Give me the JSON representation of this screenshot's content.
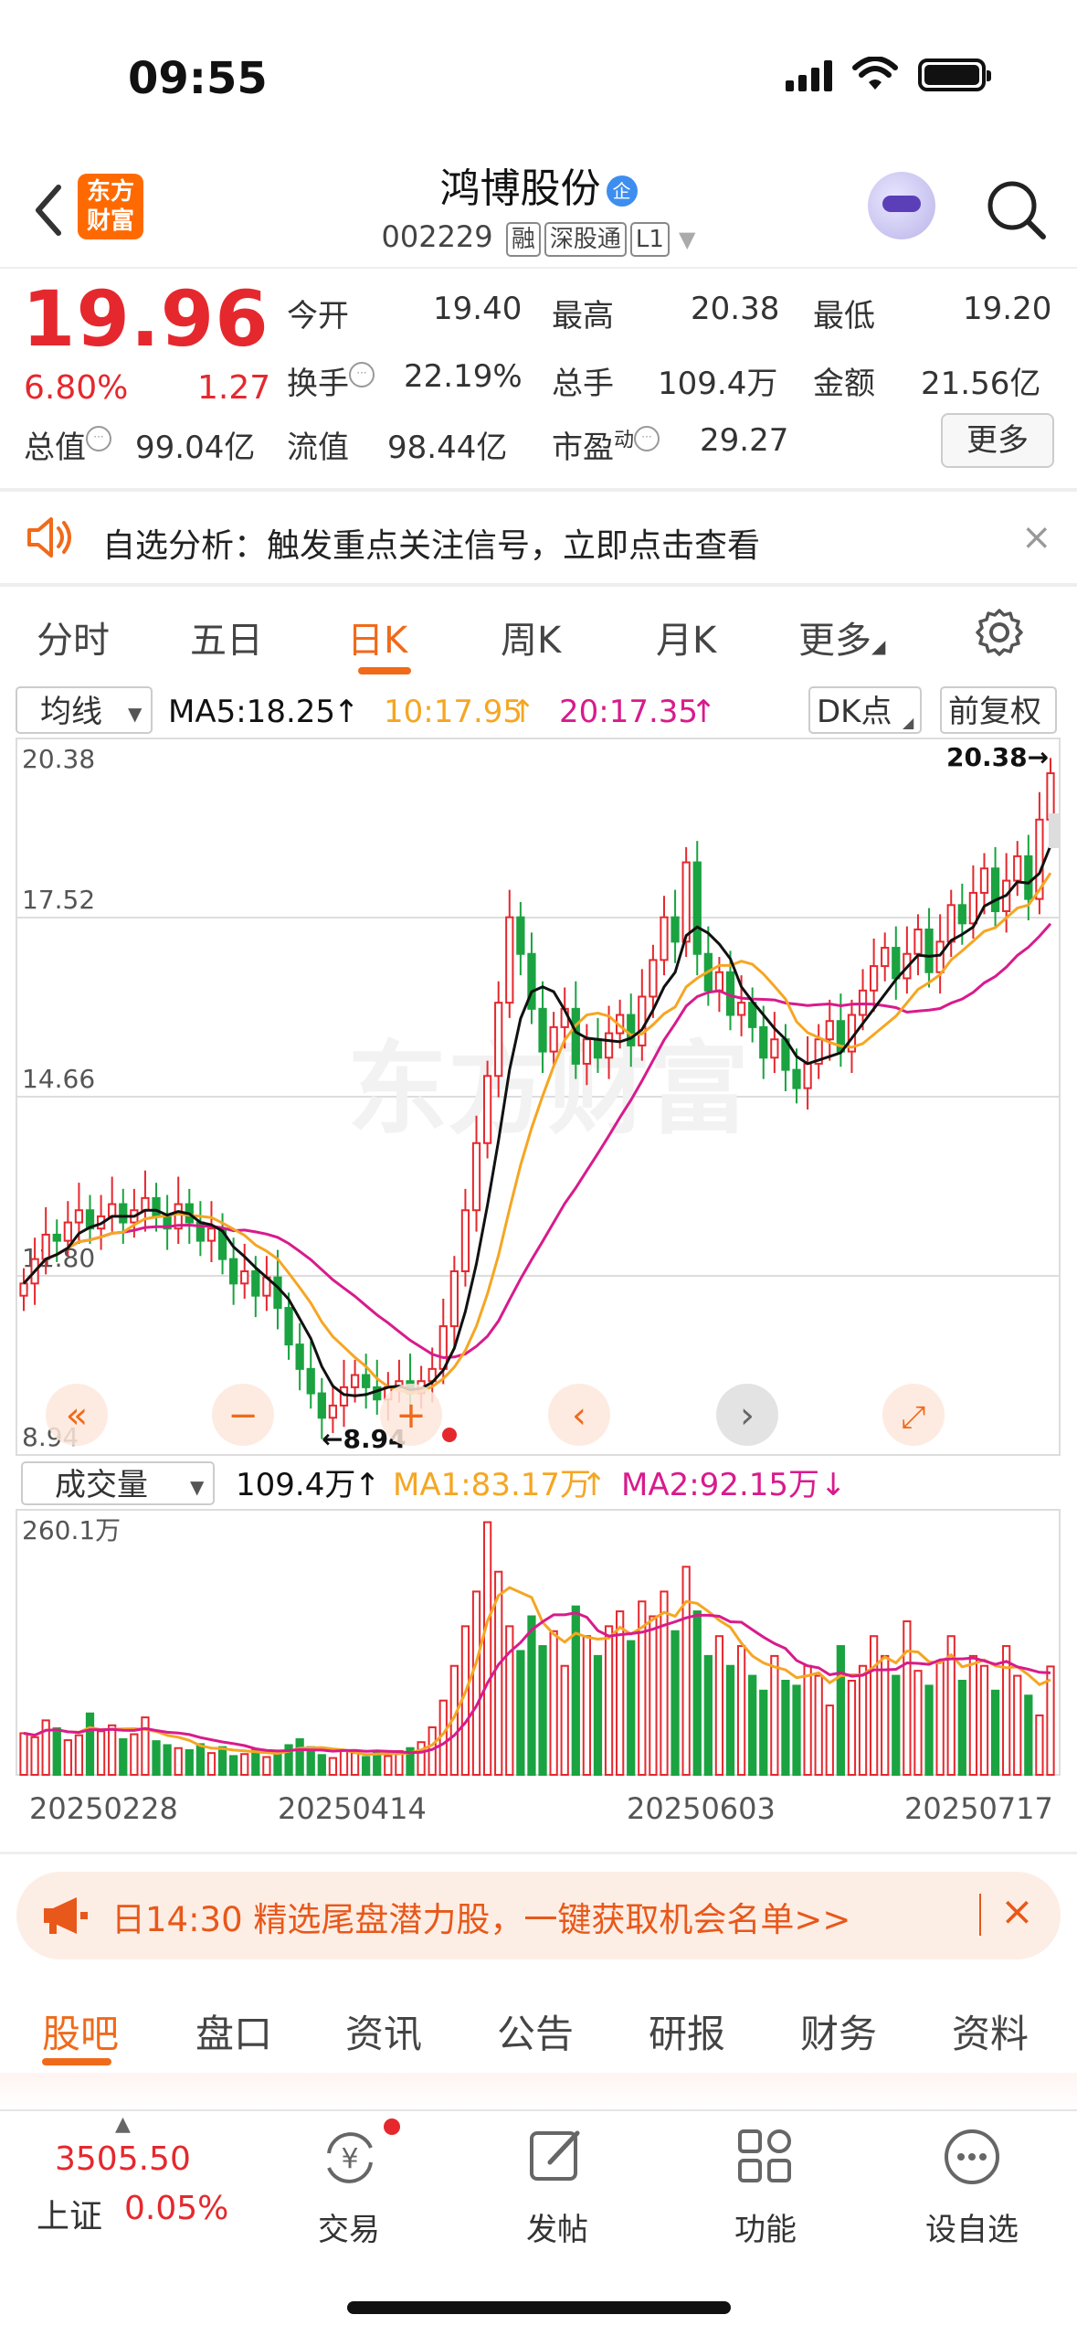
{
  "status": {
    "time": "09:55"
  },
  "header": {
    "logo": "东方\n财富",
    "name": "鸿博股份",
    "verified": "企",
    "code": "002229",
    "tags": [
      "融",
      "深股通",
      "L1"
    ]
  },
  "quote": {
    "price": "19.96",
    "change_pct": "6.80%",
    "change": "1.27",
    "rows": [
      [
        {
          "label": "今开",
          "value": "19.40"
        },
        {
          "label": "最高",
          "value": "20.38"
        },
        {
          "label": "最低",
          "value": "19.20"
        }
      ],
      [
        {
          "label": "换手",
          "value": "22.19%"
        },
        {
          "label": "总手",
          "value": "109.4万"
        },
        {
          "label": "金额",
          "value": "21.56亿"
        }
      ],
      [
        {
          "label": "总值",
          "value": "99.04亿"
        },
        {
          "label": "流值",
          "value": "98.44亿"
        },
        {
          "label": "市盈",
          "sup": "动",
          "value": "29.27"
        }
      ]
    ],
    "more": "更多"
  },
  "notice": {
    "text": "自选分析：触发重点关注信号，立即点击查看"
  },
  "tabs": [
    "分时",
    "五日",
    "日K",
    "周K",
    "月K",
    "更多"
  ],
  "kchart": {
    "selector": "均线",
    "ma5": "MA5:18.25",
    "ma10": "10:17.95",
    "ma20": "20:17.35",
    "dk": "DK点",
    "adjust": "前复权",
    "yticks": [
      "20.38",
      "17.52",
      "14.66",
      "11.80",
      "8.94"
    ],
    "high_mark": "20.38",
    "low_mark": "8.94",
    "watermark": "东方财富"
  },
  "volume": {
    "selector": "成交量",
    "value": "109.4万",
    "ma1": "MA1:83.17万",
    "ma2": "MA2:92.15万",
    "max": "260.1万",
    "dates": [
      "20250228",
      "20250414",
      "20250603",
      "20250717"
    ]
  },
  "chart_data": {
    "type": "candlestick",
    "ylim": [
      8.94,
      20.38
    ],
    "vol_max": 260.1,
    "closes": [
      11.6,
      12.0,
      12.4,
      12.3,
      12.6,
      12.8,
      12.5,
      12.7,
      12.9,
      12.6,
      12.8,
      13.0,
      12.7,
      12.5,
      12.9,
      12.6,
      12.3,
      12.5,
      12.0,
      11.6,
      11.8,
      11.4,
      11.7,
      11.2,
      10.6,
      10.2,
      9.8,
      9.4,
      9.6,
      9.9,
      10.1,
      9.9,
      9.7,
      9.9,
      10.0,
      9.8,
      10.0,
      10.2,
      10.9,
      11.8,
      12.8,
      13.9,
      15.0,
      16.2,
      17.6,
      17.0,
      16.1,
      15.4,
      15.8,
      16.1,
      15.2,
      15.6,
      15.3,
      15.7,
      16.0,
      15.5,
      16.3,
      16.9,
      17.6,
      17.2,
      18.5,
      17.0,
      16.4,
      16.7,
      16.0,
      16.2,
      15.8,
      15.3,
      15.6,
      15.1,
      14.8,
      15.2,
      15.6,
      15.9,
      15.4,
      16.0,
      16.4,
      16.8,
      17.1,
      16.6,
      17.0,
      17.4,
      16.7,
      17.2,
      17.8,
      17.5,
      18.0,
      18.4,
      17.7,
      18.2,
      18.6,
      17.9,
      19.2,
      19.96
    ],
    "volumes": [
      42,
      38,
      55,
      47,
      35,
      40,
      62,
      44,
      50,
      36,
      41,
      58,
      34,
      30,
      27,
      25,
      31,
      22,
      28,
      19,
      21,
      26,
      18,
      24,
      30,
      36,
      28,
      20,
      17,
      25,
      22,
      18,
      23,
      19,
      24,
      27,
      33,
      48,
      75,
      110,
      150,
      185,
      255,
      205,
      150,
      125,
      160,
      130,
      145,
      110,
      170,
      140,
      120,
      150,
      165,
      135,
      175,
      160,
      185,
      145,
      210,
      165,
      120,
      140,
      110,
      130,
      100,
      85,
      120,
      95,
      90,
      110,
      100,
      70,
      130,
      95,
      110,
      140,
      120,
      100,
      155,
      105,
      90,
      115,
      140,
      95,
      120,
      110,
      85,
      130,
      100,
      80,
      60,
      109.4
    ],
    "ma_labels": [
      "MA5",
      "10",
      "20"
    ]
  },
  "promo": {
    "text": "日14:30 精选尾盘潜力股，一键获取机会名单>>"
  },
  "bottom_tabs": [
    "股吧",
    "盘口",
    "资讯",
    "公告",
    "研报",
    "财务",
    "资料"
  ],
  "footer": {
    "index_value": "3505.50",
    "index_name": "上证",
    "index_change": "0.05%",
    "items": [
      "交易",
      "发帖",
      "功能",
      "设自选"
    ]
  },
  "colors": {
    "up": "#e5282e",
    "down": "#1aa340",
    "accent": "#f06a1a",
    "ma5": "#111111",
    "ma10": "#f5a623",
    "ma20": "#d81b8c"
  }
}
